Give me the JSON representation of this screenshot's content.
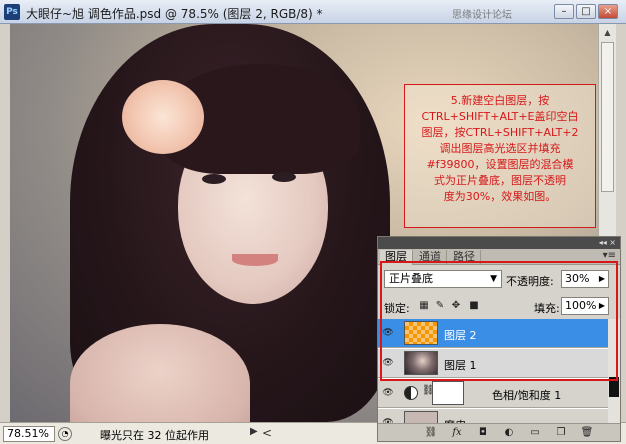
{
  "window": {
    "title": "大眼仔~旭 调色作品.psd @ 78.5% (图层 2, RGB/8) *",
    "watermark": "思缘设计论坛",
    "buttons": [
      "–",
      "□",
      "×"
    ]
  },
  "annotation": {
    "text": "5.新建空白图层，按\nCTRL+SHIFT+ALT+E盖印空白\n图层，按CTRL+SHIFT+ALT+2\n调出图层高光选区并填充\n#f39800，设置图层的混合模\n式为正片叠底，图层不透明\n度为30%，效果如图。"
  },
  "status": {
    "zoom": "78.51%",
    "message": "曝光只在 32 位起作用"
  },
  "layers_panel": {
    "tabs": [
      "图层",
      "通道",
      "路径"
    ],
    "active_tab": 0,
    "blend_mode": "正片叠底",
    "opacity_label": "不透明度:",
    "opacity": "30%",
    "lock_label": "锁定:",
    "fill_label": "填充:",
    "fill": "100%",
    "layers": [
      {
        "name": "图层 2",
        "selected": true
      },
      {
        "name": "图层 1",
        "selected": false
      },
      {
        "name": "色相/饱和度 1",
        "selected": false,
        "adjustment": true
      },
      {
        "name": "磨皮",
        "selected": false
      }
    ],
    "colors": {
      "selection": "#3a8ee6",
      "highlight": "#d6181a",
      "fill_color": "#f39800"
    }
  }
}
